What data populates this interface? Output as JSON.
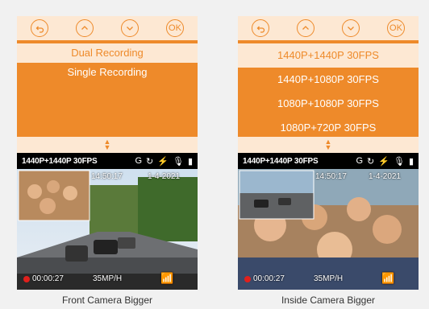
{
  "left": {
    "menu": {
      "buttons": [
        "back",
        "up",
        "down",
        "OK"
      ],
      "items": [
        "Dual Recording",
        "Single Recording"
      ],
      "selected_index": 0
    },
    "screen": {
      "resolution": "1440P+1440P 30FPS",
      "time": "14:50:17",
      "date": "1-4-2021",
      "rec_time": "00:00:27",
      "speed": "35MP/H"
    },
    "caption": "Front Camera Bigger"
  },
  "right": {
    "menu": {
      "buttons": [
        "back",
        "up",
        "down",
        "OK"
      ],
      "items": [
        "1440P+1440P 30FPS",
        "1440P+1080P 30FPS",
        "1080P+1080P 30FPS",
        "1080P+720P 30FPS"
      ],
      "selected_index": 0
    },
    "screen": {
      "resolution": "1440P+1440P 30FPS",
      "time": "14:50:17",
      "date": "1-4-2021",
      "rec_time": "00:00:27",
      "speed": "35MP/H"
    },
    "caption": "Inside Camera Bigger"
  },
  "colors": {
    "accent": "#ee8a2a",
    "light": "#fde8d3",
    "rec": "#e0201c"
  },
  "status_icons": [
    "gps-icon",
    "loop-3min-icon",
    "gsensor-icon",
    "mic-icon",
    "sdcard-icon"
  ]
}
